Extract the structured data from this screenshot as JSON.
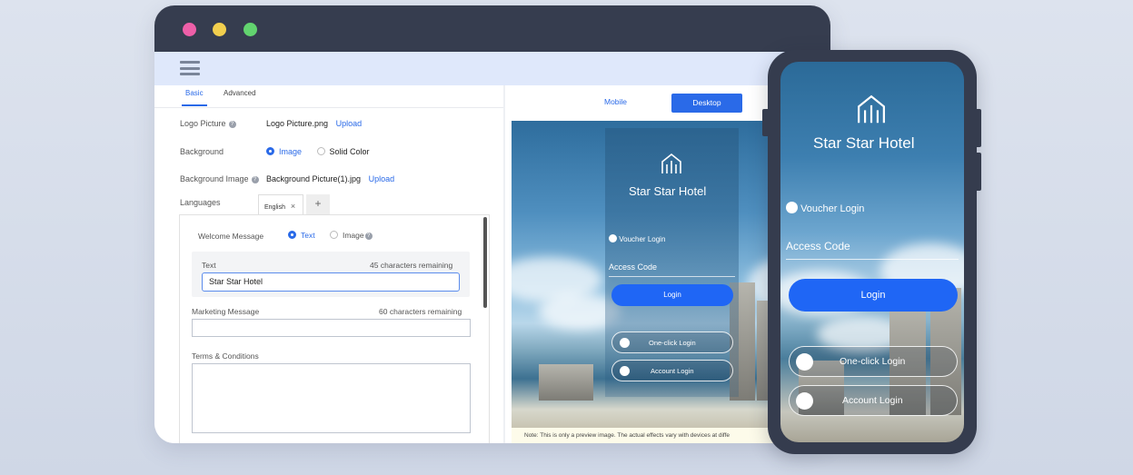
{
  "colors": {
    "accent": "#2a6ae8",
    "login_button": "#1f66f5",
    "window_dark": "#363d4f"
  },
  "window": {
    "traffic_lights": [
      "red",
      "yellow",
      "green"
    ]
  },
  "config": {
    "tabs": [
      {
        "label": "Basic",
        "active": true
      },
      {
        "label": "Advanced",
        "active": false
      }
    ],
    "logo_picture": {
      "label": "Logo Picture",
      "file": "Logo Picture.png",
      "action": "Upload"
    },
    "background": {
      "label": "Background",
      "options": [
        "Image",
        "Solid Color"
      ],
      "selected": "Image"
    },
    "background_image": {
      "label": "Background Image",
      "file": "Background Picture(1).jpg",
      "action": "Upload"
    },
    "languages": {
      "label": "Languages",
      "tab": "English",
      "close": "×",
      "add": "+"
    },
    "welcome": {
      "label": "Welcome Message",
      "options": [
        "Text",
        "Image"
      ],
      "selected": "Text"
    },
    "text_field": {
      "label": "Text",
      "remaining": "45",
      "remaining_suffix": "characters remaining",
      "value": "Star Star Hotel"
    },
    "marketing": {
      "label": "Marketing Message",
      "remaining": "60",
      "remaining_suffix": "characters remaining",
      "value": ""
    },
    "terms": {
      "label": "Terms & Conditions",
      "value": ""
    }
  },
  "preview": {
    "modes": {
      "mobile": "Mobile",
      "desktop": "Desktop",
      "selected": "Desktop"
    },
    "hotel_name": "Star Star Hotel",
    "voucher_login": "Voucher Login",
    "access_code": "Access Code",
    "login": "Login",
    "one_click_login": "One-click Login",
    "account_login": "Account Login",
    "note": "Note: This is only a preview image. The actual effects vary with devices at diffe"
  },
  "phone": {
    "hotel_name": "Star Star Hotel",
    "voucher_login": "Voucher Login",
    "access_code": "Access Code",
    "login": "Login",
    "one_click_login": "One-click Login",
    "account_login": "Account Login"
  }
}
